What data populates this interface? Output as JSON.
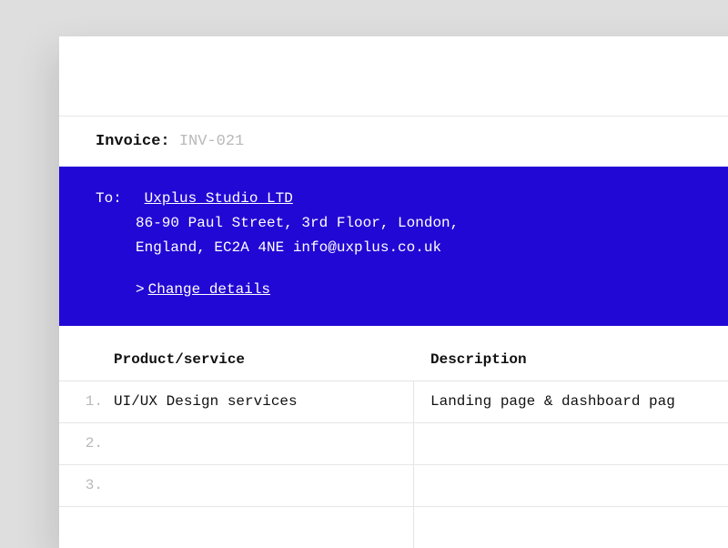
{
  "invoice": {
    "label": "Invoice:",
    "number": "INV-021"
  },
  "recipient": {
    "to_label": "To:",
    "company": "Uxplus Studio LTD",
    "address": "86-90 Paul Street, 3rd Floor, London, England, EC2A 4NE info@uxplus.co.uk",
    "change_link": "Change details",
    "chevron": ">"
  },
  "table": {
    "headers": {
      "product": "Product/service",
      "description": "Description"
    },
    "rows": [
      {
        "n": "1.",
        "product": "UI/UX Design services",
        "description": "Landing page & dashboard pag"
      },
      {
        "n": "2.",
        "product": "",
        "description": ""
      },
      {
        "n": "3.",
        "product": "",
        "description": ""
      }
    ]
  }
}
